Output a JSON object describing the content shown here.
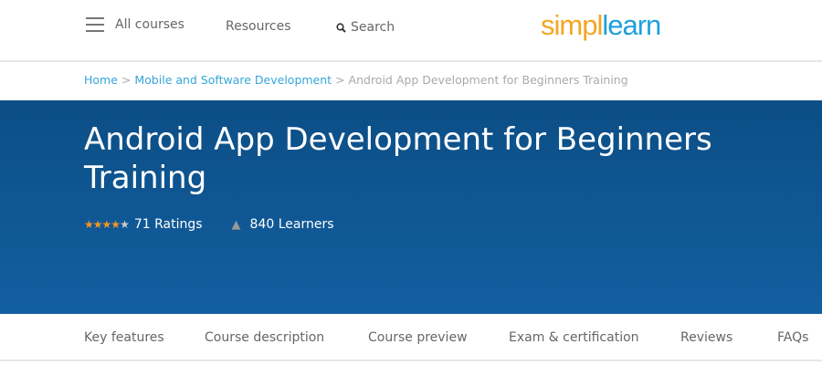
{
  "header": {
    "all_courses": "All courses",
    "resources": "Resources",
    "search": "Search",
    "logo_left": "simpl",
    "logo_right": "learn"
  },
  "breadcrumb": {
    "home": "Home",
    "category": "Mobile and Software Development",
    "current": "Android App Development for Beginners Training",
    "sep": ">"
  },
  "hero": {
    "title": "Android App Development for Beginners Training",
    "rating_stars": 4,
    "rating_max": 5,
    "ratings": "71 Ratings",
    "learners": "840 Learners"
  },
  "tabs": [
    "Key features",
    "Course description",
    "Course preview",
    "Exam & certification",
    "Reviews",
    "FAQs"
  ],
  "colors": {
    "brand_orange": "#f5a623",
    "brand_blue": "#1ea0dc",
    "hero_bg": "#0f5694"
  }
}
